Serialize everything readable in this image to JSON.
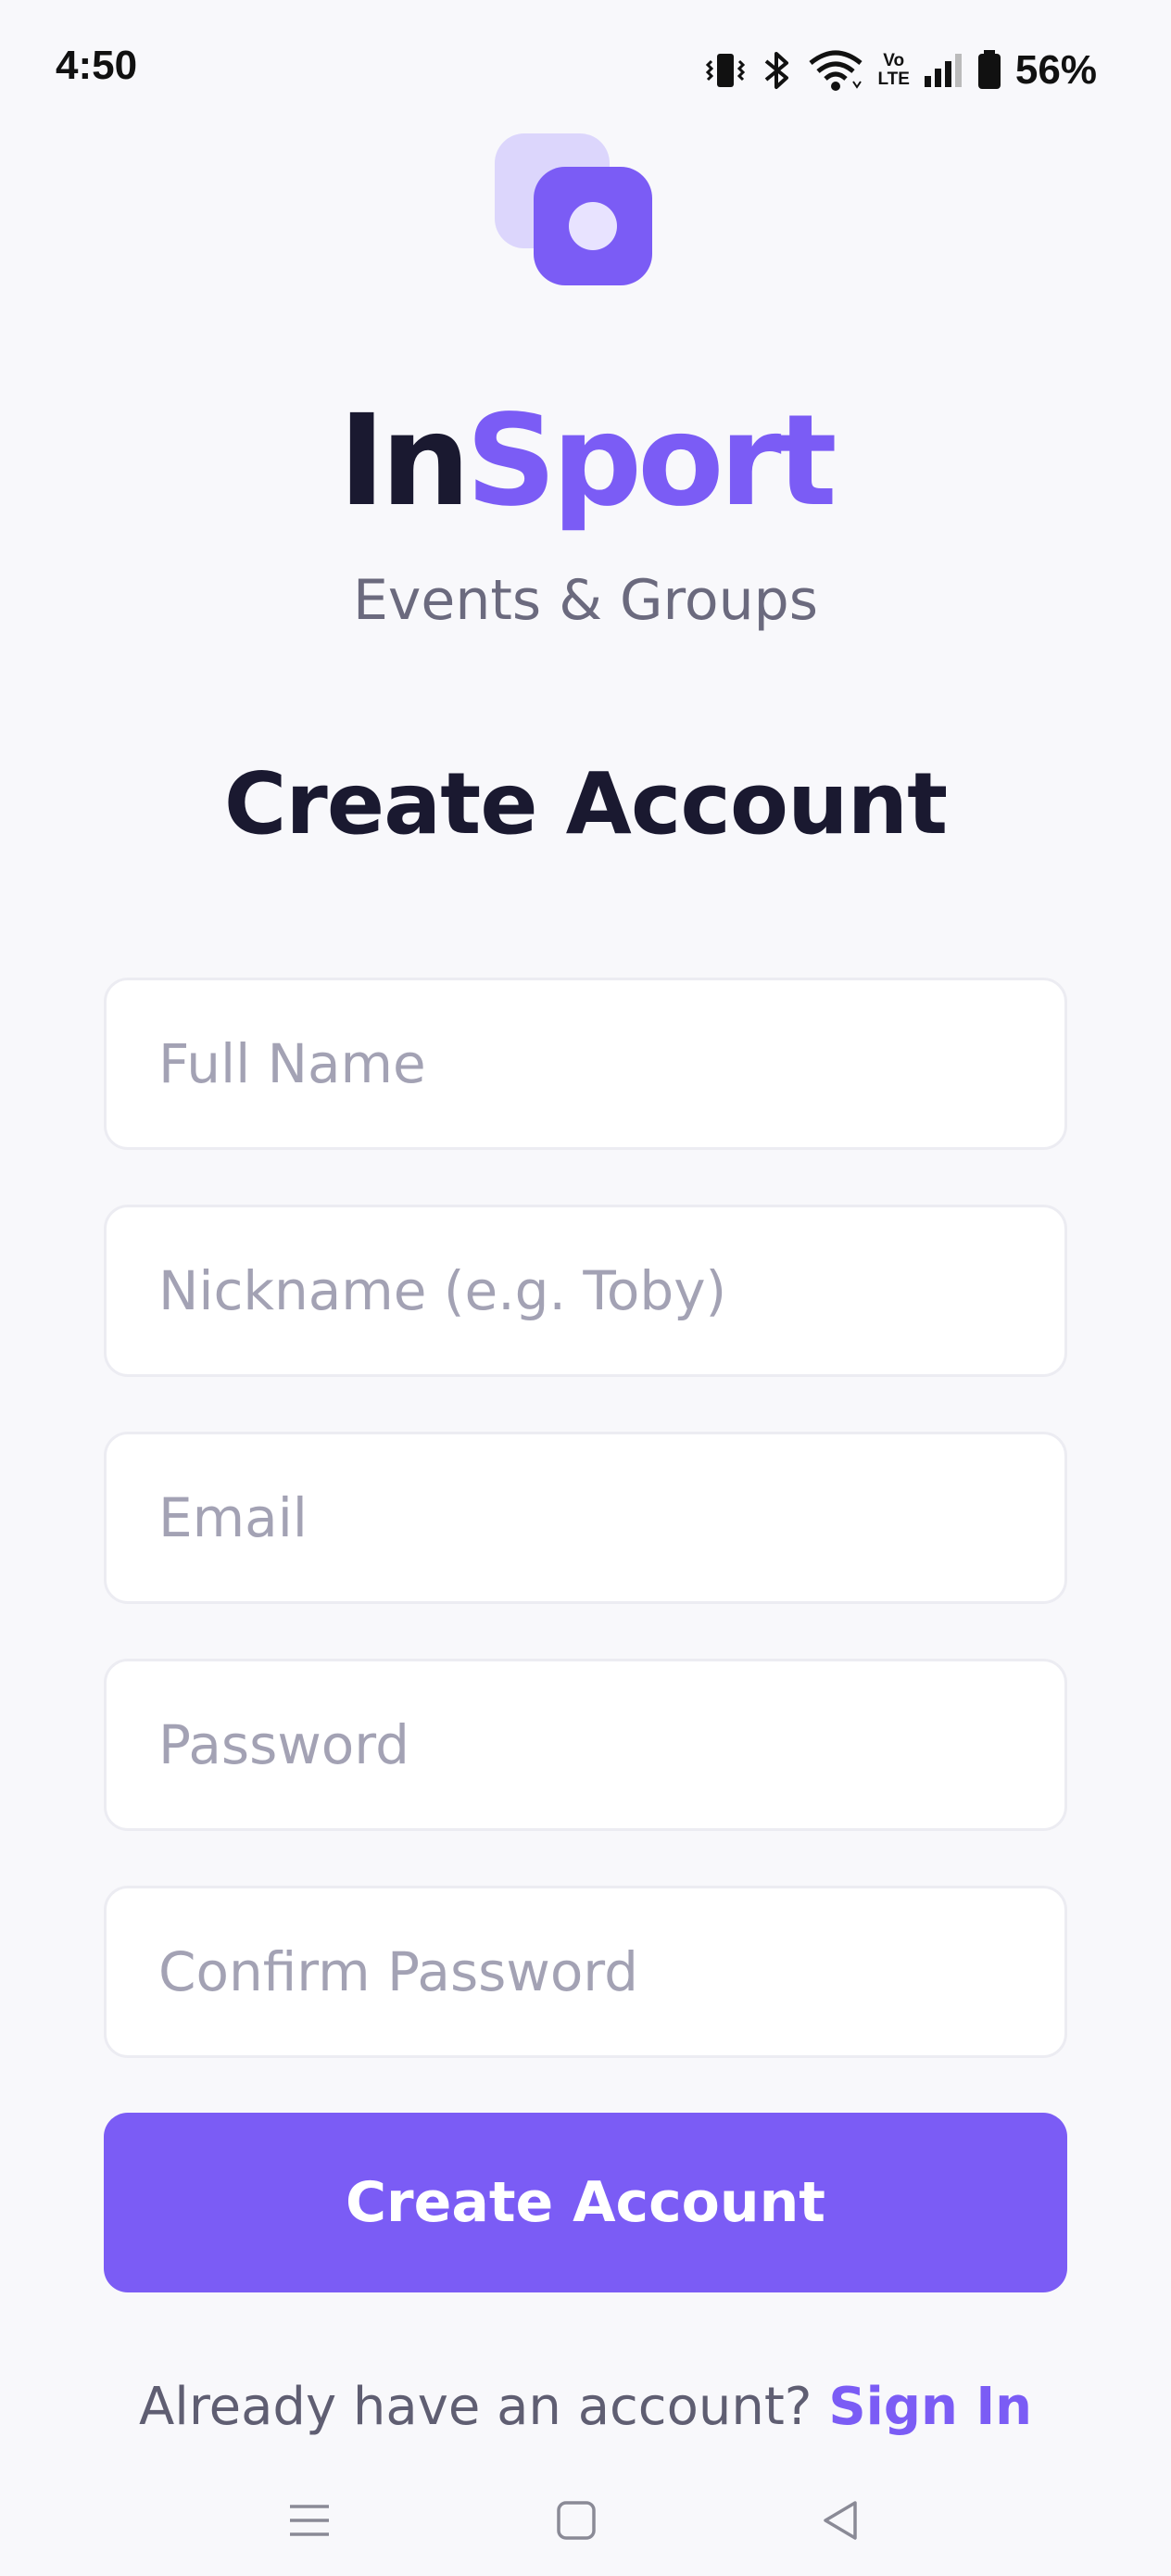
{
  "status_bar": {
    "time": "4:50",
    "battery": "56%",
    "icons": [
      "vibrate-icon",
      "bluetooth-icon",
      "wifi-icon",
      "volte-icon",
      "signal-icon",
      "battery-icon"
    ],
    "volte_top": "Vo",
    "volte_bottom": "LTE"
  },
  "brand": {
    "name_part1": "In",
    "name_part2": "Sport",
    "tagline": "Events & Groups",
    "primary_color": "#7b5cf5",
    "dark_color": "#1a1930"
  },
  "page": {
    "title": "Create Account"
  },
  "form": {
    "full_name_placeholder": "Full Name",
    "nickname_placeholder": "Nickname (e.g. Toby)",
    "email_placeholder": "Email",
    "password_placeholder": "Password",
    "confirm_password_placeholder": "Confirm Password",
    "submit_label": "Create Account"
  },
  "footer": {
    "prompt": "Already have an account?",
    "signin_label": "Sign In"
  },
  "nav_bar": {
    "icons": [
      "menu-icon",
      "home-square-icon",
      "back-triangle-icon"
    ]
  }
}
